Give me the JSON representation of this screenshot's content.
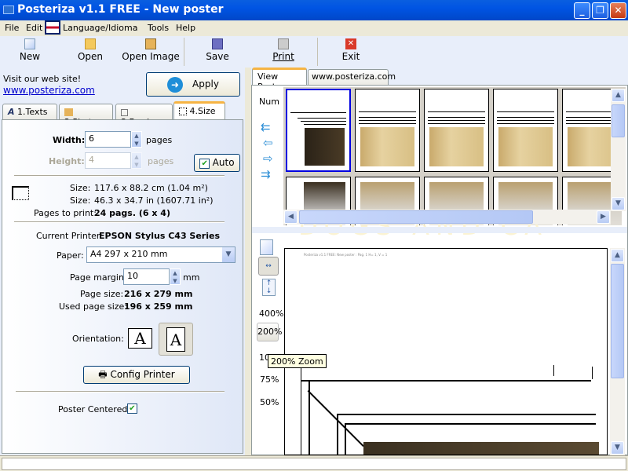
{
  "window": {
    "title": "Posteriza v1.1 FREE - New poster"
  },
  "menu": [
    "File",
    "Edit",
    "Language/Idioma",
    "Tools",
    "Help"
  ],
  "toolbar": {
    "new": "New",
    "open": "Open",
    "open_image": "Open Image",
    "save": "Save",
    "print": "Print",
    "exit": "Exit"
  },
  "left": {
    "visit": "Visit our web site!",
    "link": "www.posteriza.com",
    "apply": "Apply",
    "tabs": [
      "1.Texts",
      "2.Photo",
      "3.Border",
      "4.Size"
    ],
    "width_label": "Width:",
    "width_value": "6",
    "width_unit": "pages",
    "height_label": "Height:",
    "height_value": "4",
    "height_unit": "pages",
    "auto": "Auto",
    "auto_checked": true,
    "size_label": "Size:",
    "size_cm": "117.6 x 88.2 cm (1.04 m²)",
    "size_in": "46.3 x 34.7 in (1607.71 in²)",
    "pages_label": "Pages to print:",
    "pages_value": "24 pags. (6 x 4)",
    "printer_label": "Current Printer:",
    "printer_value": "EPSON Stylus C43 Series",
    "paper_label": "Paper:",
    "paper_value": "A4 297 x 210 mm",
    "margin_label": "Page margin:",
    "margin_value": "10",
    "margin_unit": "mm",
    "page_size_label": "Page size:",
    "page_size_value": "216 x 279 mm",
    "used_label": "Used page size:",
    "used_value": "196 x 259 mm",
    "orientation_label": "Orientation:",
    "orientation_glyph": "A",
    "orientation_selected": "portrait",
    "config": "Config Printer",
    "centered_label": "Poster Centered:",
    "centered_checked": true
  },
  "right": {
    "tabs": [
      "View Poster",
      "www.posteriza.com"
    ],
    "num": "Num",
    "poster_text": "DOGS AND CA",
    "zoom": {
      "z400": "400%",
      "z200": "200%",
      "z100": "10",
      "z75": "75%",
      "z50": "50%",
      "tooltip": "200% Zoom"
    },
    "page_header": "Posteriza v1.1 FREE: New poster : Pag. 1 H= 1, V = 1"
  }
}
